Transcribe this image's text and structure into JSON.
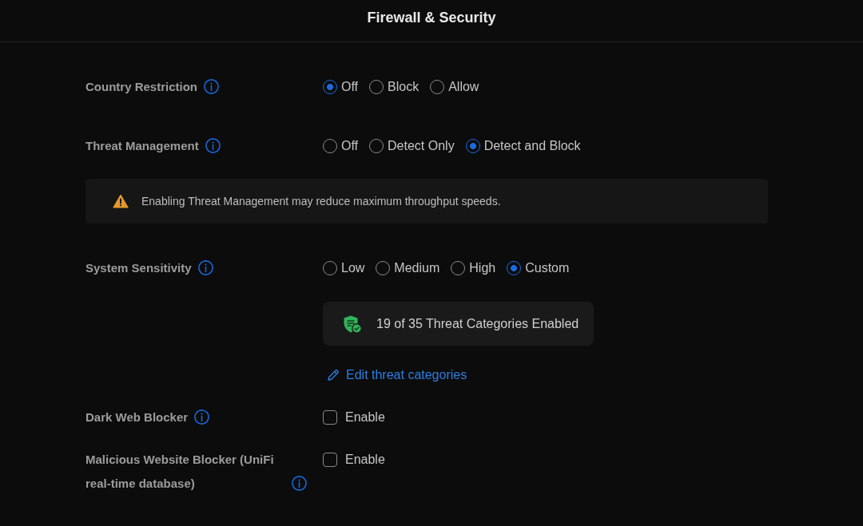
{
  "header": {
    "title": "Firewall & Security"
  },
  "settings": [
    {
      "kind": "radio",
      "label": "Country Restriction",
      "options": [
        {
          "label": "Off",
          "selected": true
        },
        {
          "label": "Block",
          "selected": false
        },
        {
          "label": "Allow",
          "selected": false
        }
      ]
    },
    {
      "kind": "radio",
      "label": "Threat Management",
      "options": [
        {
          "label": "Off",
          "selected": false
        },
        {
          "label": "Detect Only",
          "selected": false
        },
        {
          "label": "Detect and Block",
          "selected": true
        }
      ]
    },
    {
      "kind": "notice",
      "text": "Enabling Threat Management may reduce maximum throughput speeds."
    },
    {
      "kind": "radio",
      "label": "System Sensitivity",
      "options": [
        {
          "label": "Low",
          "selected": false
        },
        {
          "label": "Medium",
          "selected": false
        },
        {
          "label": "High",
          "selected": false
        },
        {
          "label": "Custom",
          "selected": true
        }
      ],
      "summary": "19 of 35 Threat Categories Enabled",
      "link": "Edit threat categories"
    },
    {
      "kind": "checkbox",
      "label": "Dark Web Blocker",
      "option": {
        "label": "Enable",
        "checked": false
      }
    },
    {
      "kind": "checkbox",
      "label": "Malicious Website Blocker (UniFi real-time database)",
      "option": {
        "label": "Enable",
        "checked": false
      }
    }
  ]
}
